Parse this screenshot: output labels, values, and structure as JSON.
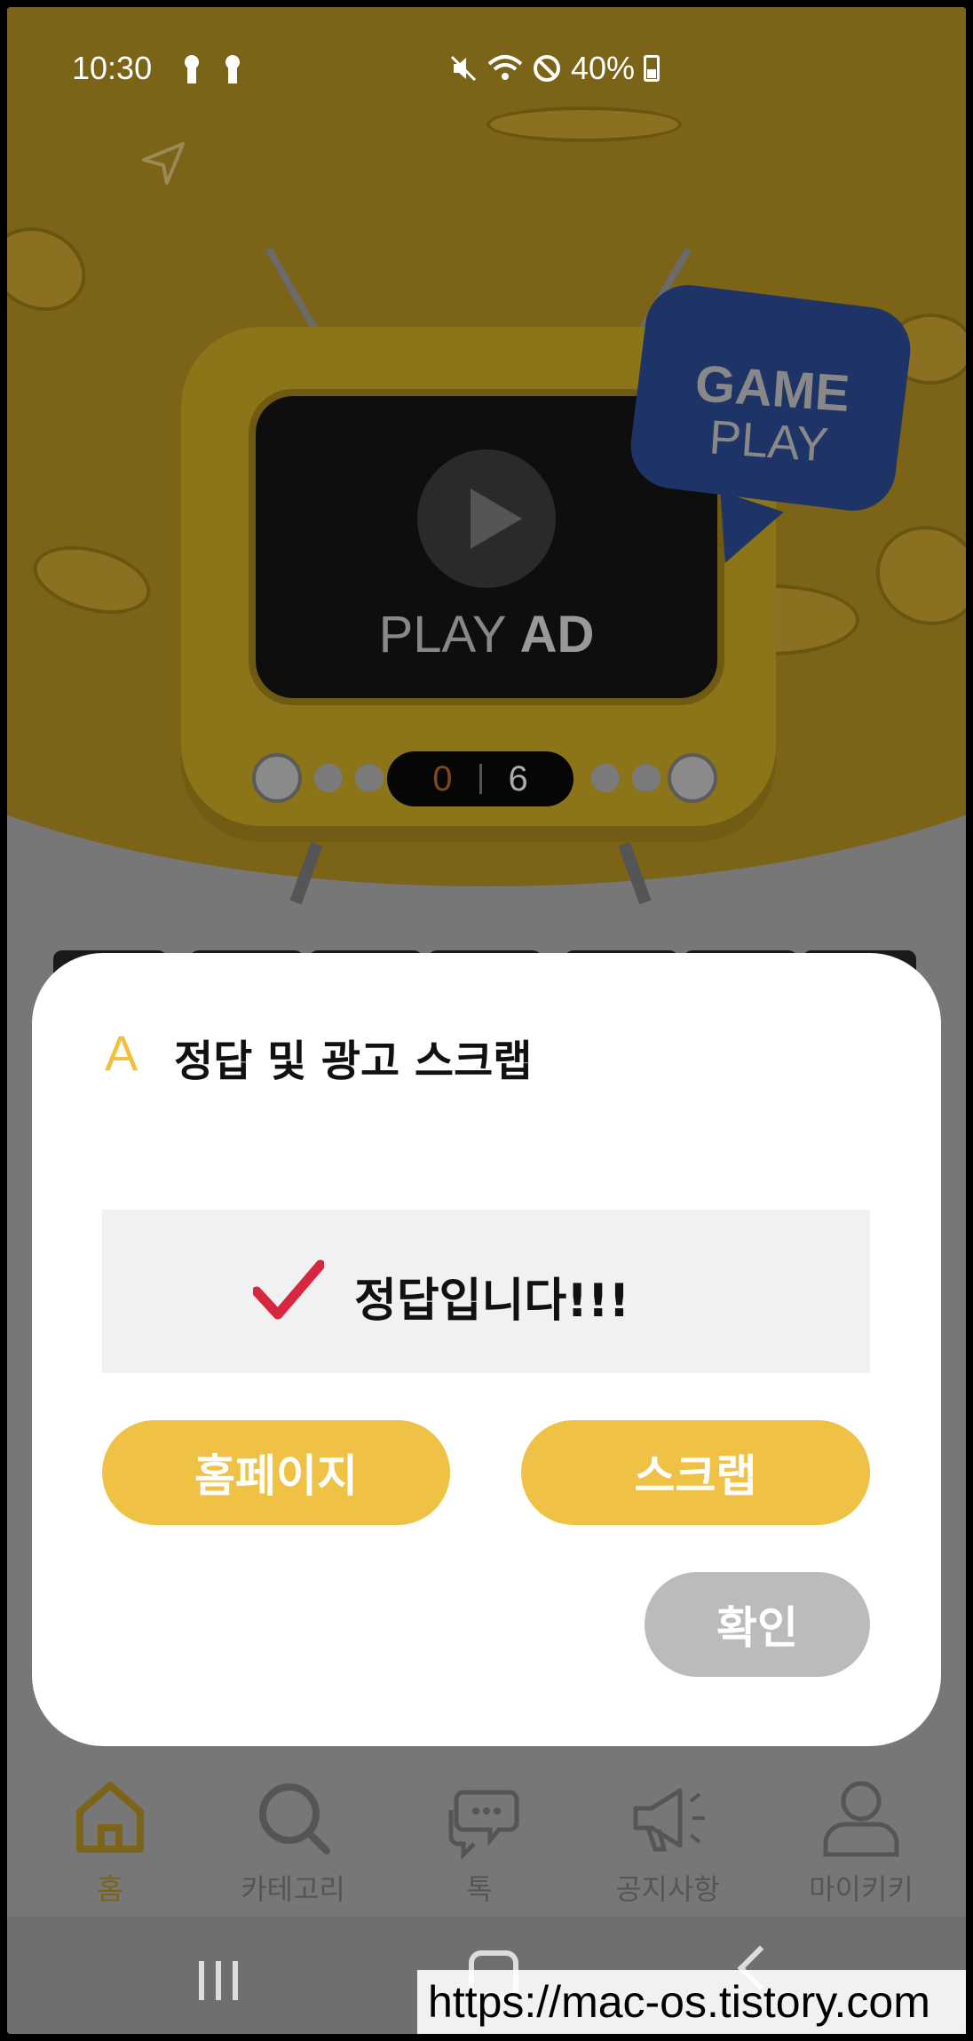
{
  "status_bar": {
    "time": "10:30",
    "battery": "40%",
    "icons": [
      "key-icon",
      "key-icon",
      "mute-icon",
      "wifi-icon",
      "do-not-disturb-icon",
      "battery-icon"
    ]
  },
  "ad_player": {
    "play_label_light": "PLAY ",
    "play_label_bold": "AD",
    "counter_current": "0",
    "counter_total": "6",
    "badge_line1": "GAME",
    "badge_line2": "PLAY"
  },
  "modal": {
    "icon_letter": "A",
    "title": "정답 및 광고 스크랩",
    "result_text": "정답입니다!!!",
    "buttons": {
      "homepage": "홈페이지",
      "scrap": "스크랩",
      "confirm": "확인"
    }
  },
  "bottom_nav": {
    "items": [
      {
        "label": "홈",
        "icon": "home-icon",
        "active": true
      },
      {
        "label": "카테고리",
        "icon": "search-icon",
        "active": false
      },
      {
        "label": "톡",
        "icon": "chat-icon",
        "active": false
      },
      {
        "label": "공지사항",
        "icon": "megaphone-icon",
        "active": false
      },
      {
        "label": "마이키키",
        "icon": "user-icon",
        "active": false
      }
    ]
  },
  "watermark": "https://mac-os.tistory.com",
  "colors": {
    "accent_yellow": "#efc245",
    "confirm_gray": "#bbbbbb",
    "check_red": "#d7263d",
    "badge_blue": "#1f3466"
  }
}
